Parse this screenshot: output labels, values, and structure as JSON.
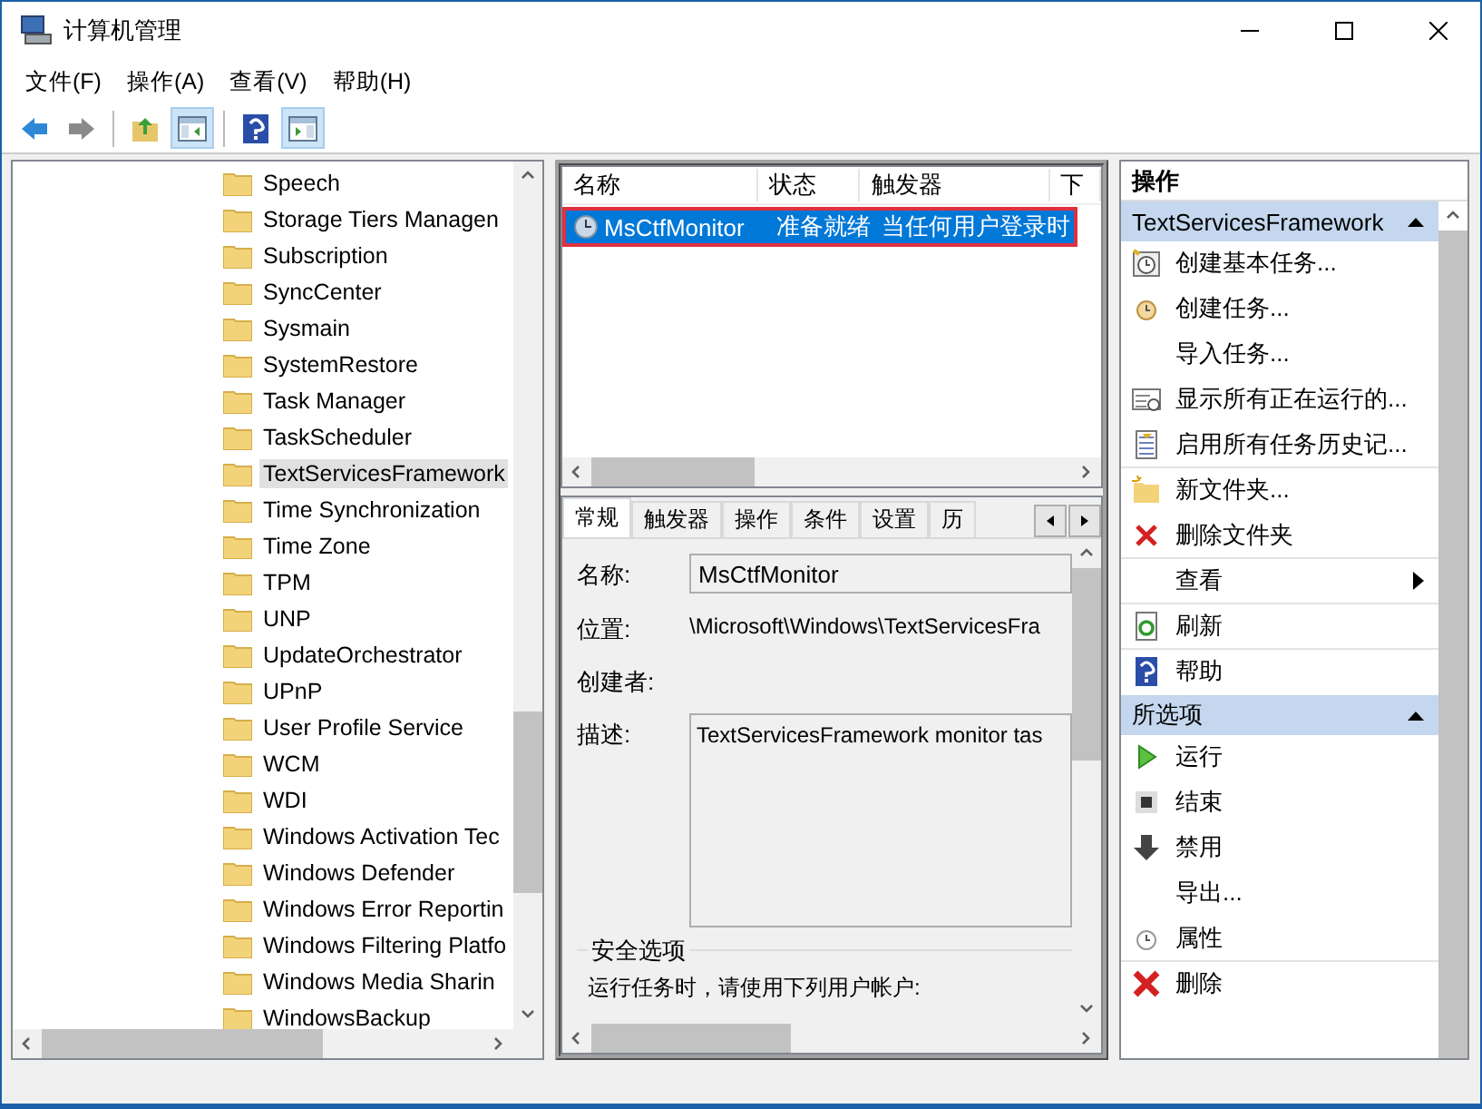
{
  "window": {
    "title": "计算机管理"
  },
  "menu": [
    "文件(F)",
    "操作(A)",
    "查看(V)",
    "帮助(H)"
  ],
  "toolbar": [
    {
      "kind": "back",
      "pressed": false
    },
    {
      "kind": "forward",
      "pressed": false
    },
    {
      "kind": "up",
      "pressed": false
    },
    {
      "kind": "tree",
      "pressed": true
    },
    {
      "kind": "help",
      "pressed": false
    },
    {
      "kind": "pane",
      "pressed": true
    }
  ],
  "tree": {
    "items": [
      {
        "label": "Speech",
        "selected": false
      },
      {
        "label": "Storage Tiers Managen",
        "selected": false
      },
      {
        "label": "Subscription",
        "selected": false
      },
      {
        "label": "SyncCenter",
        "selected": false
      },
      {
        "label": "Sysmain",
        "selected": false
      },
      {
        "label": "SystemRestore",
        "selected": false
      },
      {
        "label": "Task Manager",
        "selected": false
      },
      {
        "label": "TaskScheduler",
        "selected": false
      },
      {
        "label": "TextServicesFramework",
        "selected": true
      },
      {
        "label": "Time Synchronization",
        "selected": false
      },
      {
        "label": "Time Zone",
        "selected": false
      },
      {
        "label": "TPM",
        "selected": false
      },
      {
        "label": "UNP",
        "selected": false
      },
      {
        "label": "UpdateOrchestrator",
        "selected": false
      },
      {
        "label": "UPnP",
        "selected": false
      },
      {
        "label": "User Profile Service",
        "selected": false
      },
      {
        "label": "WCM",
        "selected": false
      },
      {
        "label": "WDI",
        "selected": false
      },
      {
        "label": "Windows Activation Tec",
        "selected": false
      },
      {
        "label": "Windows Defender",
        "selected": false
      },
      {
        "label": "Windows Error Reportin",
        "selected": false
      },
      {
        "label": "Windows Filtering Platfo",
        "selected": false
      },
      {
        "label": "Windows Media Sharin",
        "selected": false
      },
      {
        "label": "WindowsBackup",
        "selected": false
      }
    ]
  },
  "task_list": {
    "columns": [
      "名称",
      "状态",
      "触发器",
      "下"
    ],
    "rows": [
      {
        "cells": [
          "MsCtfMonitor",
          "准备就绪",
          "当任何用户登录时"
        ],
        "selected": true,
        "outlined": true
      }
    ]
  },
  "details": {
    "tabs": [
      {
        "label": "常规",
        "selected": true
      },
      {
        "label": "触发器",
        "selected": false
      },
      {
        "label": "操作",
        "selected": false
      },
      {
        "label": "条件",
        "selected": false
      },
      {
        "label": "设置",
        "selected": false
      },
      {
        "label": "历",
        "selected": false
      }
    ],
    "fields": [
      {
        "label": "名称:",
        "kind": "input",
        "value": "MsCtfMonitor"
      },
      {
        "label": "位置:",
        "kind": "text",
        "value": "\\Microsoft\\Windows\\TextServicesFra"
      },
      {
        "label": "创建者:",
        "kind": "text"
      },
      {
        "label": "描述:",
        "kind": "textarea",
        "value": "TextServicesFramework monitor tas"
      }
    ],
    "security": {
      "title": "安全选项",
      "text": "运行任务时，请使用下列用户帐户:"
    }
  },
  "actions": {
    "title": "操作",
    "sections": [
      {
        "title": "TextServicesFramework",
        "expanded": true,
        "items": [
          {
            "label": "创建基本任务...",
            "kind": "basictask",
            "submenu": false,
            "separator_after": false
          },
          {
            "label": "创建任务...",
            "kind": "task",
            "submenu": false,
            "separator_after": false
          },
          {
            "label": "导入任务...",
            "kind": "none",
            "submenu": false,
            "separator_after": false
          },
          {
            "label": "显示所有正在运行的...",
            "kind": "running",
            "submenu": false,
            "separator_after": false
          },
          {
            "label": "启用所有任务历史记...",
            "kind": "history",
            "submenu": false,
            "separator_after": true
          },
          {
            "label": "新文件夹...",
            "kind": "folder",
            "submenu": false,
            "separator_after": false
          },
          {
            "label": "删除文件夹",
            "kind": "delete",
            "submenu": false,
            "separator_after": true
          },
          {
            "label": "查看",
            "kind": "none",
            "submenu": true,
            "separator_after": true
          },
          {
            "label": "刷新",
            "kind": "refresh",
            "submenu": false,
            "separator_after": true
          },
          {
            "label": "帮助",
            "kind": "help",
            "submenu": false,
            "separator_after": false
          }
        ]
      },
      {
        "title": "所选项",
        "expanded": true,
        "items": [
          {
            "label": "运行",
            "kind": "run",
            "submenu": false,
            "separator_after": false
          },
          {
            "label": "结束",
            "kind": "end",
            "submenu": false,
            "separator_after": false
          },
          {
            "label": "禁用",
            "kind": "disable",
            "submenu": false,
            "separator_after": false
          },
          {
            "label": "导出...",
            "kind": "none",
            "submenu": false,
            "separator_after": false
          },
          {
            "label": "属性",
            "kind": "properties",
            "submenu": false,
            "separator_after": true
          },
          {
            "label": "删除",
            "kind": "bigdelete",
            "submenu": false,
            "separator_after": false
          }
        ]
      }
    ]
  }
}
